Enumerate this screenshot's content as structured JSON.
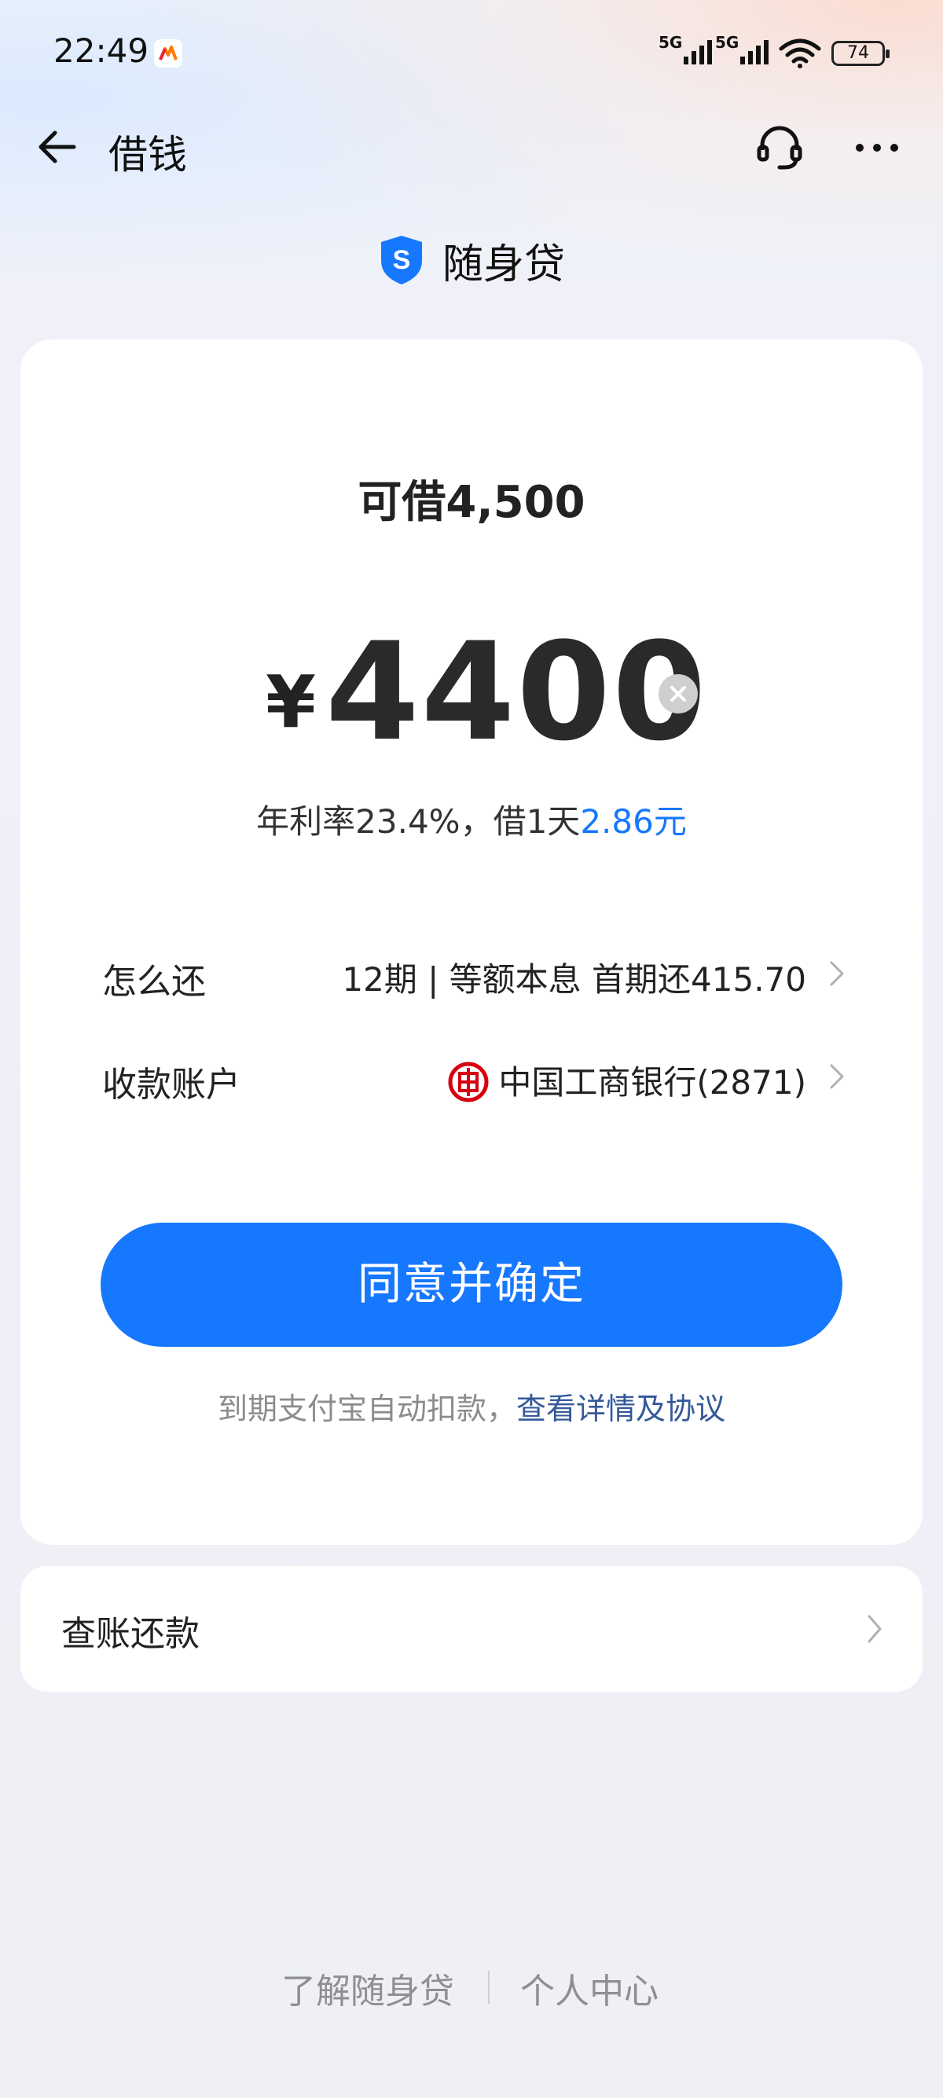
{
  "status_bar": {
    "time": "22:49",
    "network_1": "5G",
    "network_2": "5G",
    "battery": "74"
  },
  "nav": {
    "title": "借钱",
    "icons": [
      "back-arrow-icon",
      "headset-icon",
      "more-icon"
    ]
  },
  "brand": {
    "name": "随身贷",
    "logo": "shield-s-icon"
  },
  "loan": {
    "available_label": "可借4,500",
    "currency": "¥",
    "amount": "4400",
    "rate_text": "年利率23.4%，借1天",
    "daily_cost": "2.86元"
  },
  "repay": {
    "label": "怎么还",
    "value": "12期 | 等额本息 首期还415.70"
  },
  "account": {
    "label": "收款账户",
    "value": "中国工商银行(2871)"
  },
  "confirm_label": "同意并确定",
  "terms": {
    "text": "到期支付宝自动扣款，",
    "link": "查看详情及协议"
  },
  "bill_card": {
    "label": "查账还款"
  },
  "footer": {
    "link_1": "了解随身贷",
    "link_2": "个人中心"
  },
  "colors": {
    "accent": "#1677ff",
    "link": "#35589a",
    "bank_red": "#d7000f"
  }
}
